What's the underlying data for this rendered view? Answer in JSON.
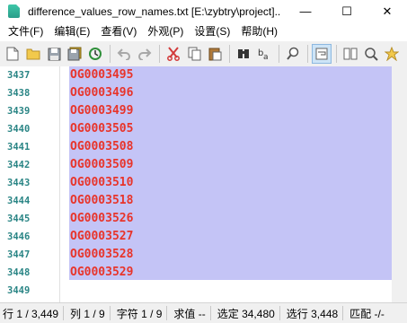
{
  "window": {
    "title": "difference_values_row_names.txt [E:\\zybtry\\project]...",
    "minimize": "—",
    "maximize": "☐",
    "close": "✕"
  },
  "menu": [
    "文件(F)",
    "编辑(E)",
    "查看(V)",
    "外观(P)",
    "设置(S)",
    "帮助(H)"
  ],
  "toolbar": {
    "icons": [
      "new-file-icon",
      "open-folder-icon",
      "save-icon",
      "save-all-icon",
      "reload-icon",
      "undo-icon",
      "redo-icon",
      "cut-icon",
      "copy-icon",
      "paste-icon",
      "find-icon",
      "replace-icon",
      "zoom-icon",
      "word-wrap-icon",
      "split-view-icon",
      "search-web-icon",
      "favorite-icon"
    ]
  },
  "editor": {
    "lines": [
      {
        "num": "3437",
        "text": "OG0003495"
      },
      {
        "num": "3438",
        "text": "OG0003496"
      },
      {
        "num": "3439",
        "text": "OG0003499"
      },
      {
        "num": "3440",
        "text": "OG0003505"
      },
      {
        "num": "3441",
        "text": "OG0003508"
      },
      {
        "num": "3442",
        "text": "OG0003509"
      },
      {
        "num": "3443",
        "text": "OG0003510"
      },
      {
        "num": "3444",
        "text": "OG0003518"
      },
      {
        "num": "3445",
        "text": "OG0003526"
      },
      {
        "num": "3446",
        "text": "OG0003527"
      },
      {
        "num": "3447",
        "text": "OG0003528"
      },
      {
        "num": "3448",
        "text": "OG0003529"
      },
      {
        "num": "3449",
        "text": ""
      }
    ],
    "colors": {
      "line_number": "#2a8585",
      "text": "#e8342a",
      "selection": "#c4c4f6"
    }
  },
  "status": {
    "line": "行 1 / 3,449",
    "column": "列 1 / 9",
    "char": "字符 1 / 9",
    "value": "求值 --",
    "selected": "选定 34,480",
    "selected_lines": "选行 3,448",
    "match": "匹配 -/-"
  }
}
